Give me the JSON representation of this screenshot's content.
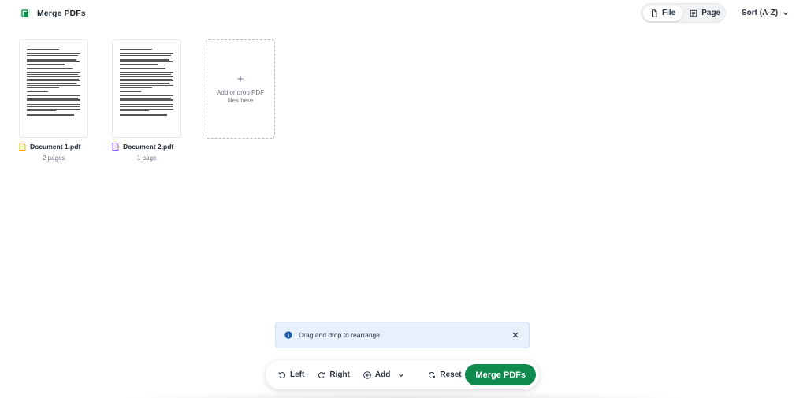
{
  "app": {
    "title": "Merge PDFs",
    "icon": "merge-pdf-icon",
    "accent": "#0e8a4f"
  },
  "view_toggle": {
    "file_label": "File",
    "page_label": "Page",
    "active": "File"
  },
  "sort": {
    "label": "Sort (A-Z)"
  },
  "files": [
    {
      "name": "Document 1.pdf",
      "pages": "2 pages",
      "icon_color": "#f5b400"
    },
    {
      "name": "Document 2.pdf",
      "pages": "1 page",
      "icon_color": "#8b5cf6"
    }
  ],
  "drop_zone": {
    "plus": "+",
    "text": "Add or drop PDF files here"
  },
  "toast": {
    "text": "Drag and drop to rearrange",
    "color": "#e8f1fb"
  },
  "toolbar": {
    "left_label": "Left",
    "right_label": "Right",
    "add_label": "Add",
    "reset_label": "Reset",
    "merge_label": "Merge PDFs"
  }
}
